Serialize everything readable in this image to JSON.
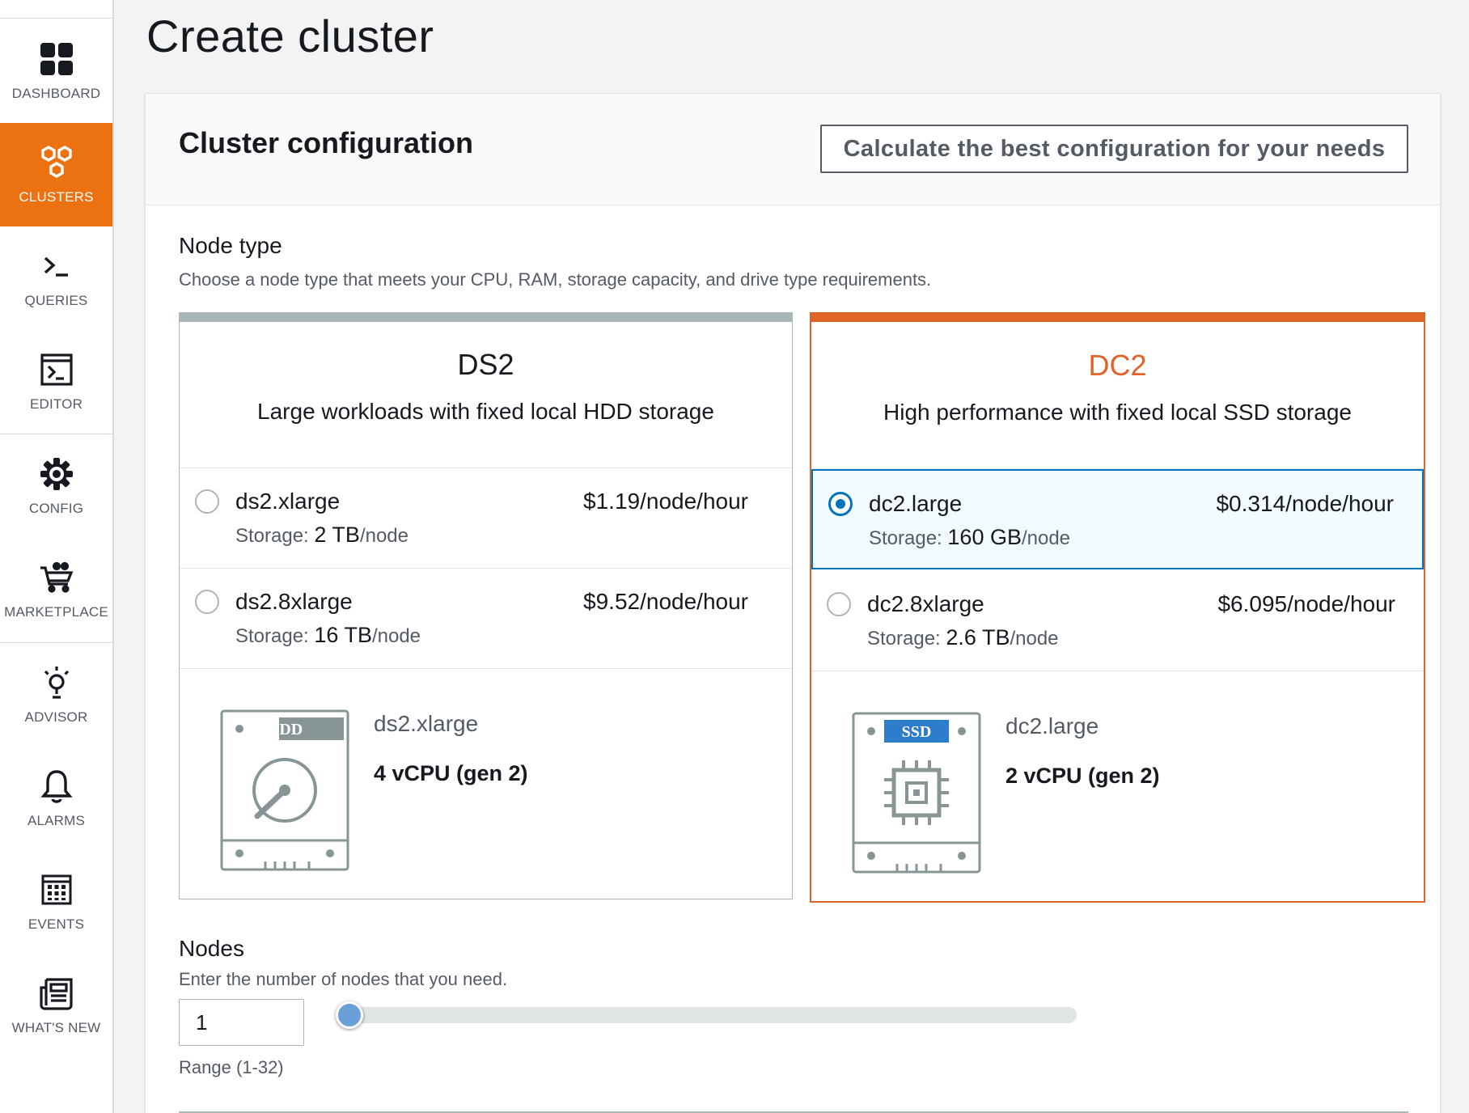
{
  "sidebar": {
    "items": [
      {
        "label": "DASHBOARD",
        "icon": "dashboard-icon",
        "active": false
      },
      {
        "label": "CLUSTERS",
        "icon": "clusters-icon",
        "active": true
      },
      {
        "label": "QUERIES",
        "icon": "queries-icon",
        "active": false
      },
      {
        "label": "EDITOR",
        "icon": "editor-icon",
        "active": false
      },
      {
        "label": "CONFIG",
        "icon": "gear-icon",
        "active": false
      },
      {
        "label": "MARKETPLACE",
        "icon": "marketplace-icon",
        "active": false
      },
      {
        "label": "ADVISOR",
        "icon": "lightbulb-icon",
        "active": false
      },
      {
        "label": "ALARMS",
        "icon": "bell-icon",
        "active": false
      },
      {
        "label": "EVENTS",
        "icon": "calendar-grid-icon",
        "active": false
      },
      {
        "label": "WHAT'S NEW",
        "icon": "newspaper-icon",
        "active": false
      }
    ]
  },
  "page": {
    "title": "Create cluster"
  },
  "config": {
    "title": "Cluster configuration",
    "calc_button": "Calculate the best configuration for your needs"
  },
  "node_type": {
    "label": "Node type",
    "description": "Choose a node type that meets your CPU, RAM, storage capacity, and drive type requirements.",
    "families": [
      {
        "name": "DS2",
        "description": "Large workloads with fixed local HDD storage",
        "selected": false,
        "drive_badge": "HDD",
        "options": [
          {
            "name": "ds2.xlarge",
            "price": "$1.19/node/hour",
            "storage_label": "Storage:",
            "storage_value": "2 TB",
            "storage_unit": "/node",
            "selected": false
          },
          {
            "name": "ds2.8xlarge",
            "price": "$9.52/node/hour",
            "storage_label": "Storage:",
            "storage_value": "16 TB",
            "storage_unit": "/node",
            "selected": false
          }
        ],
        "spec": {
          "name": "ds2.xlarge",
          "cpu": "4 vCPU (gen 2)"
        }
      },
      {
        "name": "DC2",
        "description": "High performance with fixed local SSD storage",
        "selected": true,
        "drive_badge": "SSD",
        "options": [
          {
            "name": "dc2.large",
            "price": "$0.314/node/hour",
            "storage_label": "Storage:",
            "storage_value": "160 GB",
            "storage_unit": "/node",
            "selected": true
          },
          {
            "name": "dc2.8xlarge",
            "price": "$6.095/node/hour",
            "storage_label": "Storage:",
            "storage_value": "2.6 TB",
            "storage_unit": "/node",
            "selected": false
          }
        ],
        "spec": {
          "name": "dc2.large",
          "cpu": "2 vCPU (gen 2)"
        }
      }
    ]
  },
  "nodes": {
    "label": "Nodes",
    "description": "Enter the number of nodes that you need.",
    "value": "1",
    "range_hint": "Range (1-32)",
    "slider_fraction": 0.0
  },
  "colors": {
    "accent": "#ec7211",
    "selected_family": "#e0642a",
    "selected_option": "#0073bb",
    "slider_thumb": "#6b9fd8"
  }
}
